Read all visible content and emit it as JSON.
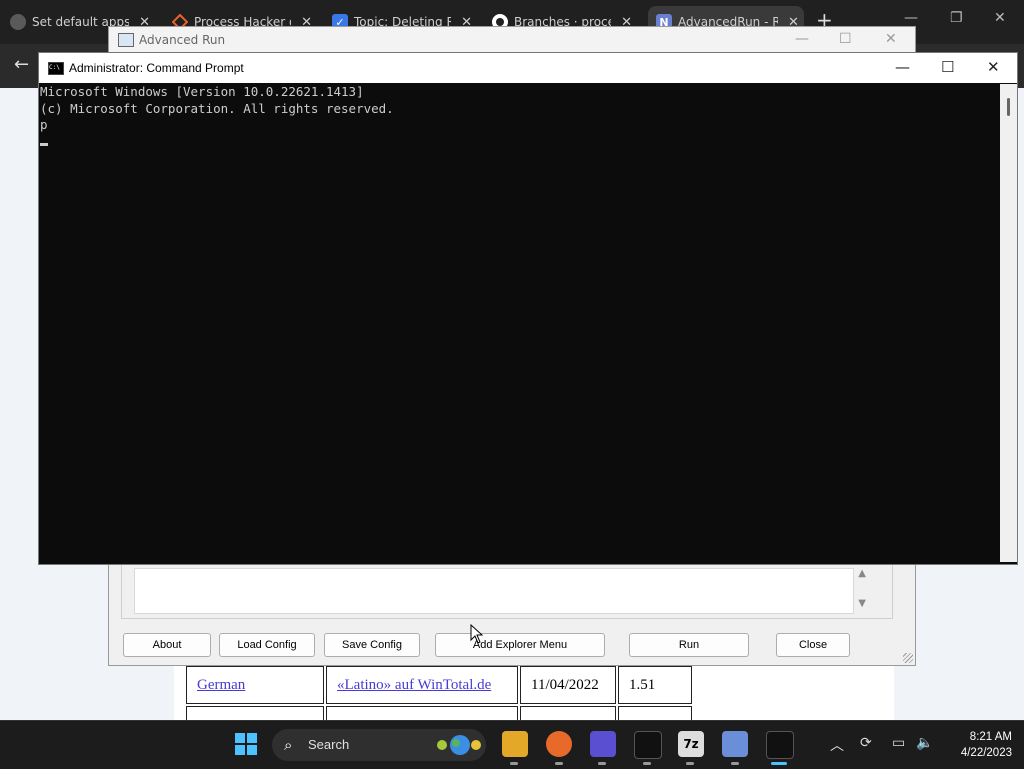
{
  "browser": {
    "tabs": [
      {
        "title": "Set default apps in",
        "icon": "globe-icon",
        "color": "#5a5a5a",
        "active": false
      },
      {
        "title": "Process Hacker do",
        "icon": "process-hacker-icon",
        "color": "#e8632b",
        "active": false
      },
      {
        "title": "Topic: Deleting Reg",
        "icon": "checkbox-icon",
        "color": "#3b78e7",
        "active": false
      },
      {
        "title": "Branches · processh",
        "icon": "github-icon",
        "color": "#ffffff",
        "active": false
      },
      {
        "title": "AdvancedRun - Ru",
        "icon": "nirsoft-icon",
        "color": "#6a7fd0",
        "active": true
      }
    ],
    "tab_close": "✕",
    "new_tab": "+"
  },
  "advanced_run": {
    "title": "Advanced Run",
    "buttons": {
      "about": "About",
      "load_config": "Load Config",
      "save_config": "Save Config",
      "add_explorer_menu": "Add Explorer Menu",
      "run": "Run",
      "close": "Close"
    }
  },
  "cmd": {
    "title": "Administrator: Command Prompt",
    "lines": [
      "Microsoft Windows [Version 10.0.22621.1413]",
      "(c) Microsoft Corporation. All rights reserved.",
      "p"
    ]
  },
  "webpage": {
    "table_row": {
      "language": "German",
      "translator": "«Latino» auf WinTotal.de",
      "date": "11/04/2022",
      "version": "1.51"
    }
  },
  "taskbar": {
    "search_label": "Search",
    "time": "8:21 AM",
    "date": "4/22/2023"
  }
}
